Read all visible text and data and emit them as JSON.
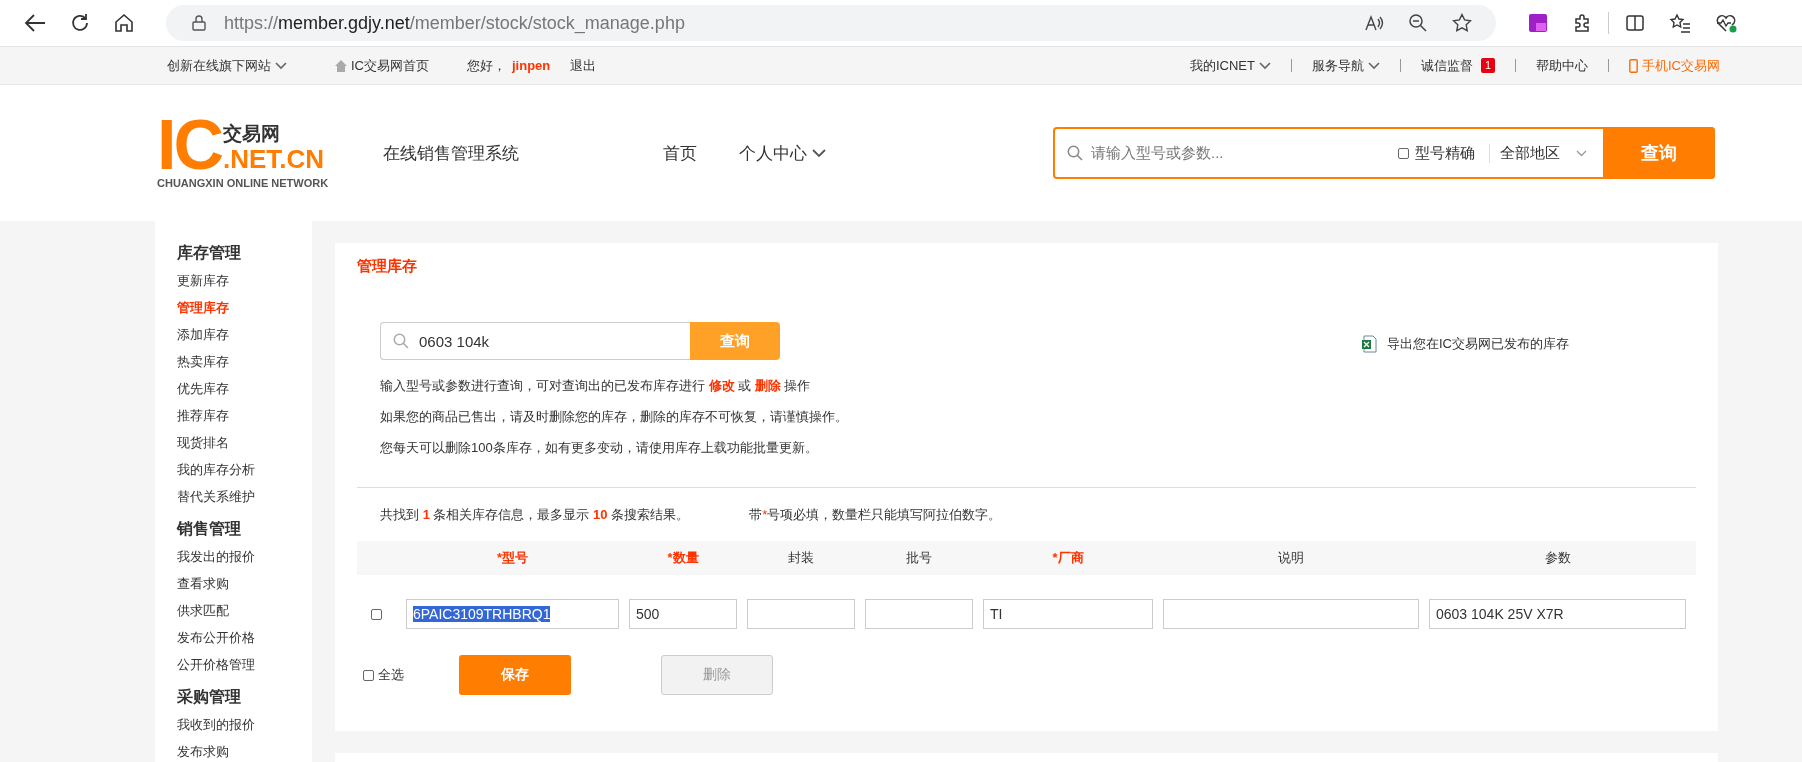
{
  "browser": {
    "url_scheme": "https://",
    "url_host": "member.gdjy.net",
    "url_path": "/member/stock/stock_manage.php"
  },
  "topbar": {
    "left": [
      {
        "kind": "dropdown",
        "label": "创新在线旗下网站"
      },
      {
        "kind": "home",
        "label": "IC交易网首页"
      },
      {
        "kind": "greeting",
        "label": "您好，",
        "user": "jinpen"
      },
      {
        "kind": "link",
        "label": "退出"
      }
    ],
    "right": [
      {
        "kind": "dropdown",
        "label": "我的ICNET"
      },
      {
        "kind": "dropdown",
        "label": "服务导航"
      },
      {
        "kind": "badge",
        "label": "诚信监督",
        "badge": "1"
      },
      {
        "kind": "link",
        "label": "帮助中心"
      },
      {
        "kind": "mobile",
        "label": "手机IC交易网"
      }
    ]
  },
  "header": {
    "logo": {
      "mark": "IC",
      "cn": "交易网",
      "domain": ".NET.CN",
      "tagline": "CHUANGXIN ONLINE NETWORK"
    },
    "system_name": "在线销售管理系统",
    "nav": [
      {
        "label": "首页",
        "dropdown": false
      },
      {
        "label": "个人中心",
        "dropdown": true
      }
    ],
    "search": {
      "placeholder": "请输入型号或参数...",
      "exact_label": "型号精确",
      "exact_checked": false,
      "region": "全部地区",
      "button": "查询"
    }
  },
  "sidebar": [
    {
      "title": "库存管理",
      "items": [
        {
          "label": "更新库存",
          "selected": false
        },
        {
          "label": "管理库存",
          "selected": true
        },
        {
          "label": "添加库存",
          "selected": false
        },
        {
          "label": "热卖库存",
          "selected": false
        },
        {
          "label": "优先库存",
          "selected": false
        },
        {
          "label": "推荐库存",
          "selected": false
        },
        {
          "label": "现货排名",
          "selected": false
        },
        {
          "label": "我的库存分析",
          "selected": false
        },
        {
          "label": "替代关系维护",
          "selected": false
        }
      ]
    },
    {
      "title": "销售管理",
      "items": [
        {
          "label": "我发出的报价",
          "selected": false
        },
        {
          "label": "查看求购",
          "selected": false
        },
        {
          "label": "供求匹配",
          "selected": false
        },
        {
          "label": "发布公开价格",
          "selected": false
        },
        {
          "label": "公开价格管理",
          "selected": false
        }
      ]
    },
    {
      "title": "采购管理",
      "items": [
        {
          "label": "我收到的报价",
          "selected": false
        },
        {
          "label": "发布求购",
          "selected": false
        }
      ]
    }
  ],
  "main": {
    "title": "管理库存",
    "search": {
      "value": "0603 104k",
      "button": "查询"
    },
    "export_link": "导出您在IC交易网已发布的库存",
    "help": [
      "输入型号或参数进行查询，可对查询出的已发布库存进行 **修改** 或 **删除** 操作",
      "如果您的商品已售出，请及时删除您的库存，删除的库存不可恢复，请谨慎操作。",
      "您每天可以删除100条库存，如有更多变动，请使用库存上载功能批量更新。"
    ],
    "result_count": "共找到 **1** 条相关库存信息，最多显示 **10** 条搜索结果。",
    "required_note": {
      "before": "带",
      "mark": "*",
      "after": "号项必填，数量栏只能填写阿拉伯数字。"
    },
    "table": {
      "columns": [
        {
          "label": "*型号",
          "required": true
        },
        {
          "label": "*数量",
          "required": true
        },
        {
          "label": "封装",
          "required": false
        },
        {
          "label": "批号",
          "required": false
        },
        {
          "label": "*厂商",
          "required": true
        },
        {
          "label": "说明",
          "required": false
        },
        {
          "label": "参数",
          "required": false
        }
      ],
      "rows": [
        {
          "checked": false,
          "cells": [
            {
              "value": "6PAIC3109TRHBRQ1",
              "highlighted": true
            },
            {
              "value": "500",
              "highlighted": false
            },
            {},
            {},
            {
              "value": "TI",
              "highlighted": false
            },
            {},
            {
              "value": "0603 104K 25V X7R",
              "highlighted": false
            }
          ]
        }
      ]
    },
    "select_all": {
      "label": "全选",
      "checked": false
    },
    "save_button": "保存",
    "delete_button": {
      "label": "删除",
      "disabled": true
    }
  }
}
